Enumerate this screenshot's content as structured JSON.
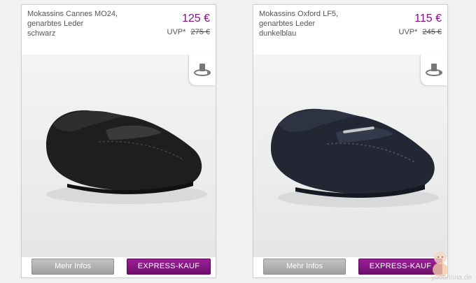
{
  "products": [
    {
      "name_line1": "Mokassins Cannes MO24,",
      "name_line2": "genarbtes Leder",
      "color": "schwarz",
      "price": "125 €",
      "uvp_label": "UVP*",
      "uvp_price": "275 €",
      "more_label": "Mehr Infos",
      "express_label": "EXPRESS-KAUF",
      "shoe_color": "#1e1e1e"
    },
    {
      "name_line1": "Mokassins Oxford LF5,",
      "name_line2": "genarbtes Leder",
      "color": "dunkelblau",
      "price": "115 €",
      "uvp_label": "UVP*",
      "uvp_price": "245 €",
      "more_label": "Mehr Infos",
      "express_label": "EXPRESS-KAUF",
      "shoe_color": "#222733"
    }
  ],
  "watermark": "yoobrinna.de",
  "colors": {
    "price": "#8a0f86",
    "express": "#7d1279",
    "more": "#a8a8a8"
  },
  "icons": {
    "rotate": "rotate-360-icon"
  }
}
